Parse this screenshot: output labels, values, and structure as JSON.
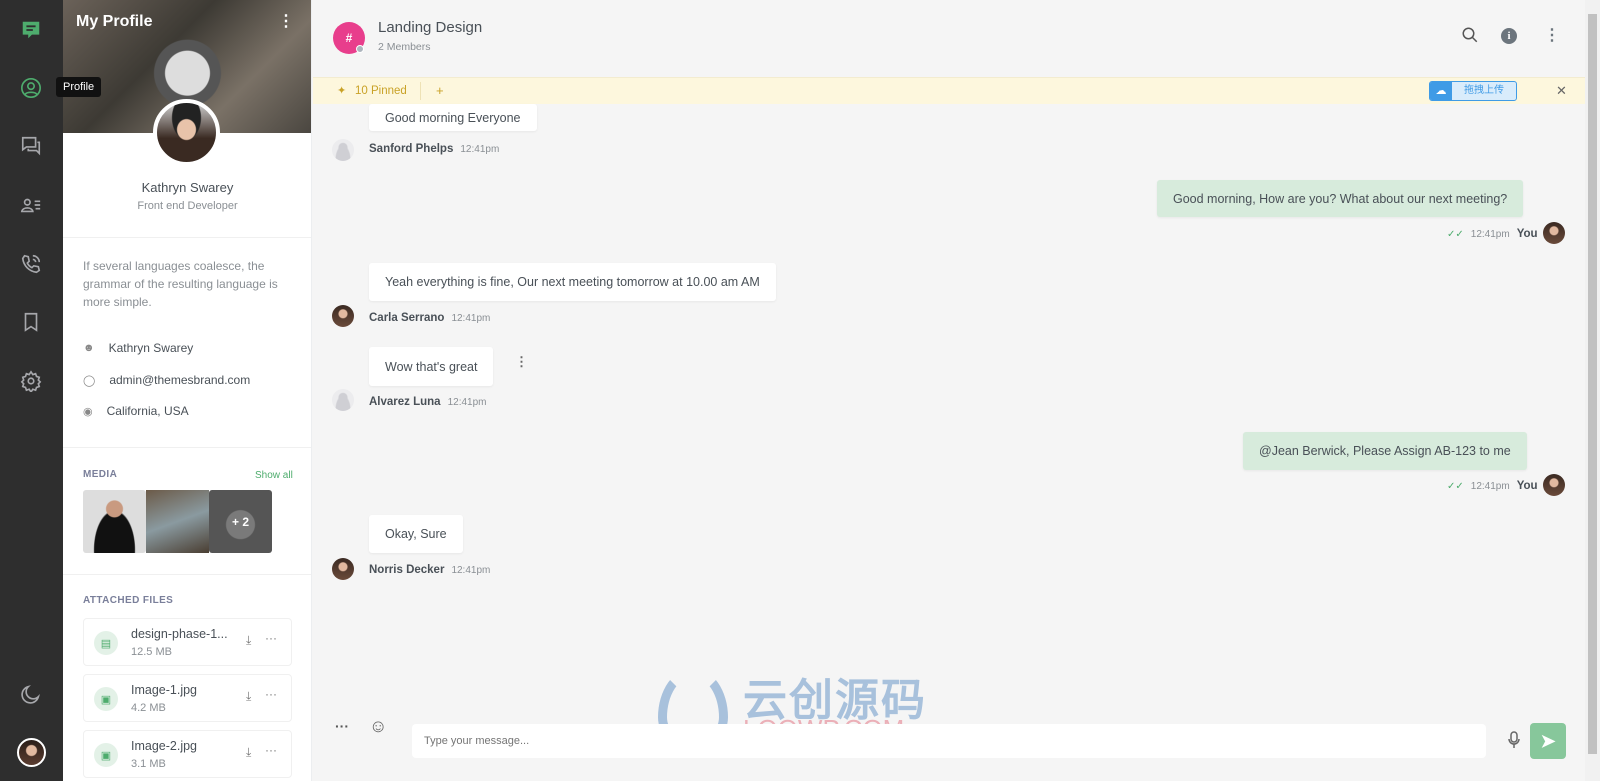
{
  "nav": {
    "items": [
      {
        "name": "chats",
        "icon": "message-square-icon"
      },
      {
        "name": "profile",
        "icon": "user-circle-icon",
        "active": true
      },
      {
        "name": "messages",
        "icon": "chat-bubbles-icon"
      },
      {
        "name": "contacts",
        "icon": "contacts-icon"
      },
      {
        "name": "calls",
        "icon": "phone-call-icon"
      },
      {
        "name": "bookmarks",
        "icon": "bookmark-icon"
      },
      {
        "name": "settings",
        "icon": "gear-icon"
      }
    ],
    "tooltip": "Profile",
    "theme_icon": "moon-icon",
    "accent": "#4eac6d"
  },
  "profile": {
    "title": "My Profile",
    "name": "Kathryn Swarey",
    "role": "Front end Developer",
    "bio": "If several languages coalesce, the grammar of the resulting language is more simple.",
    "info": [
      {
        "icon": "user-icon",
        "text": "Kathryn Swarey"
      },
      {
        "icon": "message-icon",
        "text": "admin@themesbrand.com"
      },
      {
        "icon": "location-icon",
        "text": "California, USA"
      }
    ],
    "media_title": "MEDIA",
    "show_all": "Show all",
    "media_more": "+ 2",
    "files_title": "ATTACHED FILES",
    "files": [
      {
        "name": "design-phase-1...",
        "size": "12.5 MB",
        "icon": "file-text-icon"
      },
      {
        "name": "Image-1.jpg",
        "size": "4.2 MB",
        "icon": "image-icon"
      },
      {
        "name": "Image-2.jpg",
        "size": "3.1 MB",
        "icon": "image-icon"
      }
    ]
  },
  "chat": {
    "title": "Landing Design",
    "subtitle": "2 Members",
    "channel_symbol": "#",
    "channel_color": "#e83e8c",
    "pinned": "10 Pinned",
    "pinned_add": "+",
    "upload_ext_label": "拖拽上传",
    "messages": [
      {
        "text": "Good morning Everyone",
        "author": "Sanford Phelps",
        "time": "12:41pm",
        "mine": false
      },
      {
        "text": "Good morning, How are you? What about our next meeting?",
        "author": "You",
        "time": "12:41pm",
        "mine": true
      },
      {
        "text": "Yeah everything is fine, Our next meeting tomorrow at 10.00 am AM",
        "author": "Carla Serrano",
        "time": "12:41pm",
        "mine": false
      },
      {
        "text": "Wow that's great",
        "author": "Alvarez Luna",
        "time": "12:41pm",
        "mine": false
      },
      {
        "text": "@Jean Berwick, Please Assign AB-123 to me",
        "author": "You",
        "time": "12:41pm",
        "mine": true
      },
      {
        "text": "Okay, Sure",
        "author": "Norris Decker",
        "time": "12:41pm",
        "mine": false
      }
    ],
    "input_placeholder": "Type your message...",
    "watermark": {
      "cn": "云创源码",
      "en": "LOOWP.COM"
    }
  }
}
